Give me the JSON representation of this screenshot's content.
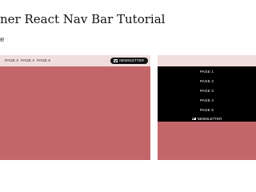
{
  "header": {
    "title": "ner React Nav Bar Tutorial",
    "subtitle": "e"
  },
  "desktop": {
    "nav_links": [
      "PAGE 3",
      "PAGE 4",
      "PAGE 5"
    ],
    "newsletter_label": "NEWSLETTER"
  },
  "mobile": {
    "menu_items": [
      "PAGE 1",
      "PAGE 2",
      "PAGE 3",
      "PAGE 4",
      "PAGE 5"
    ],
    "newsletter_label": "NEWSLETTER"
  },
  "colors": {
    "nav_background": "#efdedd",
    "body_background": "#c3666a",
    "menu_background": "#000000",
    "button_background": "#111111"
  },
  "icons": {
    "newsletter": "mail-icon"
  }
}
